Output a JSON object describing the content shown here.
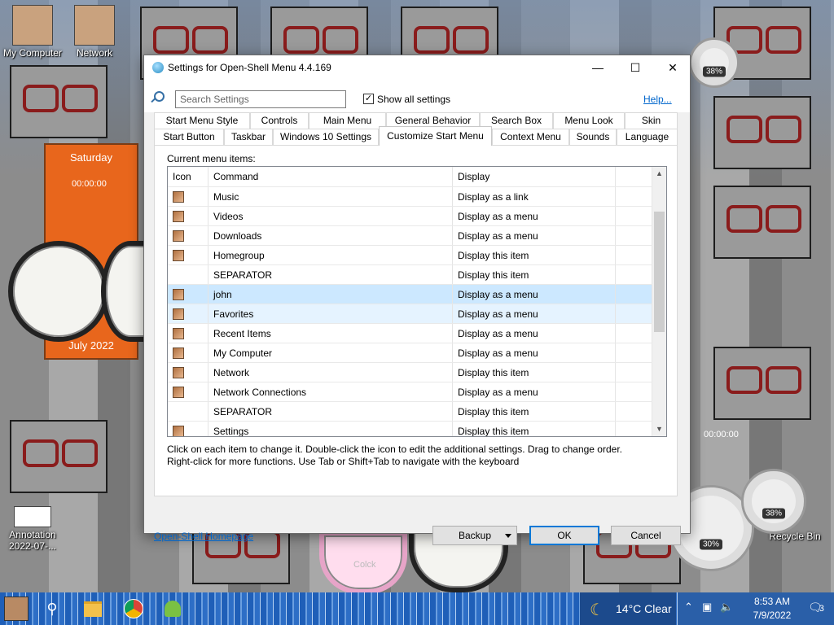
{
  "desktop": {
    "icons": [
      {
        "label": "My Computer"
      },
      {
        "label": "Network"
      },
      {
        "label": "Annotation 2022-07-..."
      },
      {
        "label": "Recycle Bin"
      }
    ],
    "calendar": {
      "day": "Saturday",
      "month": "July 2022"
    },
    "timer_label": "00:00:00",
    "gauges": [
      "38%",
      "30%",
      "38%"
    ],
    "cute_clock_label": "Colck"
  },
  "dialog": {
    "title": "Settings for Open-Shell Menu 4.4.169",
    "search_placeholder": "Search Settings",
    "show_all_checked": "✓",
    "show_all_label": "Show all settings",
    "help_label": "Help...",
    "tabs_row1": [
      "Start Menu Style",
      "Controls",
      "Main Menu",
      "General Behavior",
      "Search Box",
      "Menu Look",
      "Skin"
    ],
    "tabs_row2": [
      "Start Button",
      "Taskbar",
      "Windows 10 Settings",
      "Customize Start Menu",
      "Context Menu",
      "Sounds",
      "Language"
    ],
    "active_tab": "Customize Start Menu",
    "panel_label": "Current menu items:",
    "columns": {
      "icon": "Icon",
      "command": "Command",
      "display": "Display"
    },
    "rows": [
      {
        "command": "Music",
        "display": "Display as a link",
        "icon": true
      },
      {
        "command": "Videos",
        "display": "Display as a menu",
        "icon": true
      },
      {
        "command": "Downloads",
        "display": "Display as a menu",
        "icon": true
      },
      {
        "command": "Homegroup",
        "display": "Display this item",
        "icon": true
      },
      {
        "command": "SEPARATOR",
        "display": "Display this item",
        "icon": false
      },
      {
        "command": "john",
        "display": "Display as a menu",
        "icon": true
      },
      {
        "command": "Favorites",
        "display": "Display as a menu",
        "icon": true
      },
      {
        "command": "Recent Items",
        "display": "Display as a menu",
        "icon": true
      },
      {
        "command": "My Computer",
        "display": "Display as a menu",
        "icon": true
      },
      {
        "command": "Network",
        "display": "Display this item",
        "icon": true
      },
      {
        "command": "Network Connections",
        "display": "Display as a menu",
        "icon": true
      },
      {
        "command": "SEPARATOR",
        "display": "Display this item",
        "icon": false
      },
      {
        "command": "Settings",
        "display": "Display this item",
        "icon": true
      }
    ],
    "hint_line1": "Click on each item to change it. Double-click the icon to edit the additional settings. Drag to change order.",
    "hint_line2": "Right-click for more functions. Use Tab or Shift+Tab to navigate with the keyboard",
    "homepage_link": "Open-Shell Homepage",
    "backup_label": "Backup",
    "ok_label": "OK",
    "cancel_label": "Cancel"
  },
  "taskbar": {
    "weather": {
      "temp": "14°C  Clear"
    },
    "time": "8:53 AM",
    "date": "7/9/2022",
    "notification_count": "3"
  }
}
